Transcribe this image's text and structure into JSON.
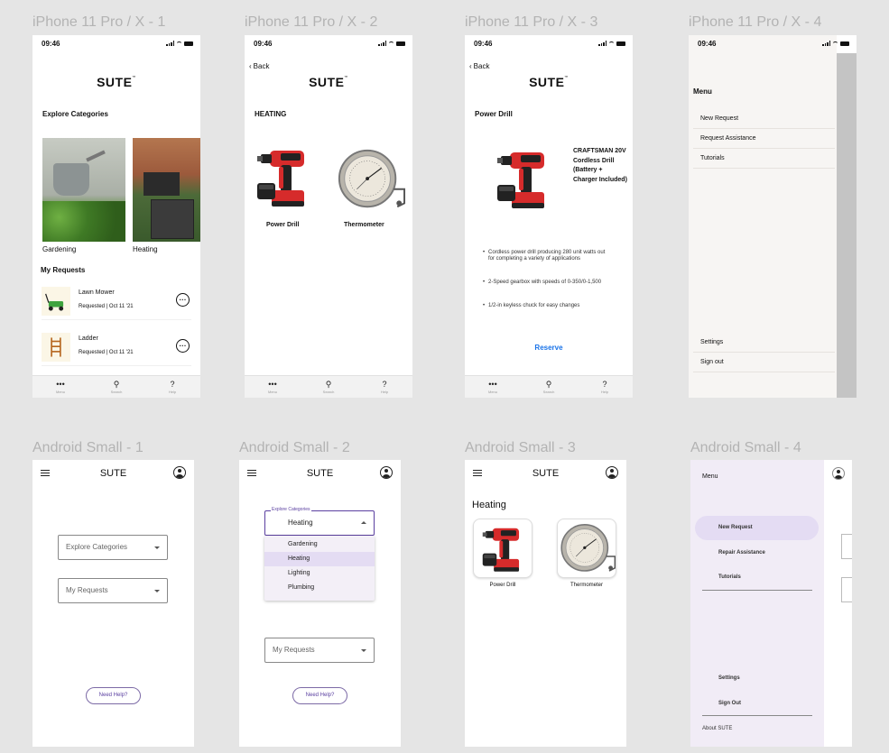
{
  "frames": {
    "ios1": "iPhone 11 Pro / X - 1",
    "ios2": "iPhone 11 Pro / X - 2",
    "ios3": "iPhone 11 Pro / X - 3",
    "ios4": "iPhone 11 Pro / X - 4",
    "and1": "Android Small - 1",
    "and2": "Android Small - 2",
    "and3": "Android Small - 3",
    "and4": "Android Small - 4"
  },
  "status_time": "09:46",
  "logo": "SUTE",
  "logo_mark": "™",
  "back_label": "Back",
  "tabbar": {
    "menu": "Menu",
    "search": "Search",
    "help": "Help"
  },
  "home": {
    "explore_title": "Explore Categories",
    "categories": [
      "Gardening",
      "Heating"
    ],
    "requests_title": "My Requests",
    "requests": [
      {
        "name": "Lawn Mower",
        "status": "Requested | Oct 11 '21"
      },
      {
        "name": "Ladder",
        "status": "Requested | Oct 11 '21"
      }
    ]
  },
  "heating": {
    "title": "HEATING",
    "products": [
      "Power Drill",
      "Thermometer"
    ]
  },
  "detail": {
    "title": "Power Drill",
    "product_name": "CRAFTSMAN 20V Cordless Drill (Battery + Charger Included)",
    "bullets": [
      "Cordless power drill producing 280 unit watts out for completing a variety of applications",
      "2-Speed gearbox with speeds of 0-350/0-1,500",
      "1/2-in keyless chuck for easy changes"
    ],
    "reserve": "Reserve"
  },
  "ios_menu": {
    "title": "Menu",
    "items": [
      "New Request",
      "Request Assistance",
      "Tutorials"
    ],
    "bottom": [
      "Settings",
      "Sign out"
    ]
  },
  "android": {
    "app_title": "SUTE",
    "explore_select": "Explore Categories",
    "requests_select": "My Requests",
    "help": "Need Help?",
    "dropdown_label": "Explore Categories",
    "dropdown_value": "Heating",
    "dropdown_options": [
      "Gardening",
      "Heating",
      "Lighting",
      "Plumbing"
    ],
    "heating_title": "Heating",
    "products": [
      "Power Drill",
      "Thermometer"
    ],
    "drawer": {
      "title": "Menu",
      "items": [
        "New Request",
        "Repair Assistance",
        "Tutorials"
      ],
      "bottom": [
        "Settings",
        "Sign Out"
      ],
      "about": "About SUTE"
    }
  },
  "colors": {
    "accent_blue": "#1a73e8",
    "android_purple": "#5a3fa0",
    "drawer_bg": "#f1ecf6",
    "drawer_selected": "#e4dcf3"
  }
}
